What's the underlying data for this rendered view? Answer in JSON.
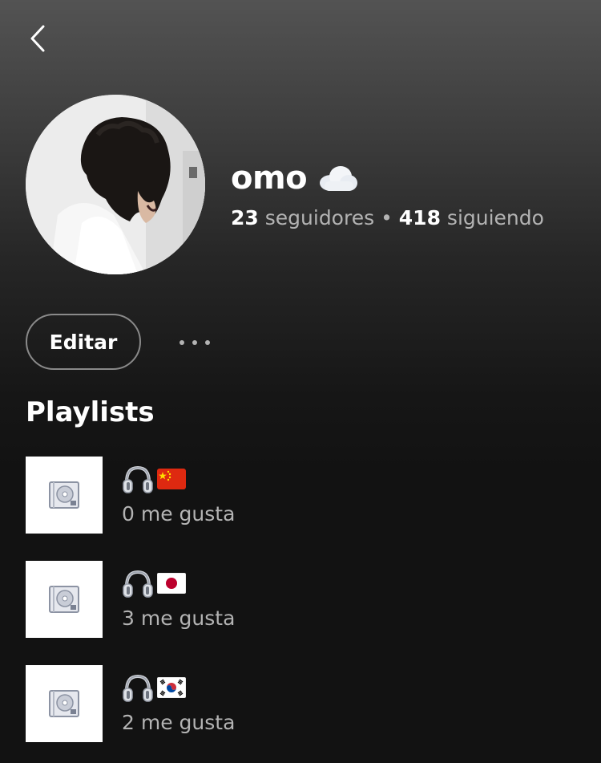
{
  "header": {
    "back_icon": "chevron-left-icon"
  },
  "profile": {
    "name": "omo",
    "name_icon": "cloud-icon",
    "followers_count": "23",
    "followers_label": "seguidores",
    "separator": "•",
    "following_count": "418",
    "following_label": "siguiendo"
  },
  "actions": {
    "edit_label": "Editar",
    "more_icon": "more-horizontal-icon"
  },
  "playlists_section": {
    "title": "Playlists",
    "items": [
      {
        "title_icons": [
          "headphones-icon",
          "china-flag-icon"
        ],
        "likes": "0 me gusta",
        "cover_icon": "cd-case-icon"
      },
      {
        "title_icons": [
          "headphones-icon",
          "japan-flag-icon"
        ],
        "likes": "3 me gusta",
        "cover_icon": "cd-case-icon"
      },
      {
        "title_icons": [
          "headphones-icon",
          "south-korea-flag-icon"
        ],
        "likes": "2 me gusta",
        "cover_icon": "cd-case-icon"
      }
    ]
  },
  "colors": {
    "background": "#121212",
    "header_gradient_top": "#535353",
    "secondary_text": "#b3b3b3",
    "primary_text": "#ffffff"
  }
}
